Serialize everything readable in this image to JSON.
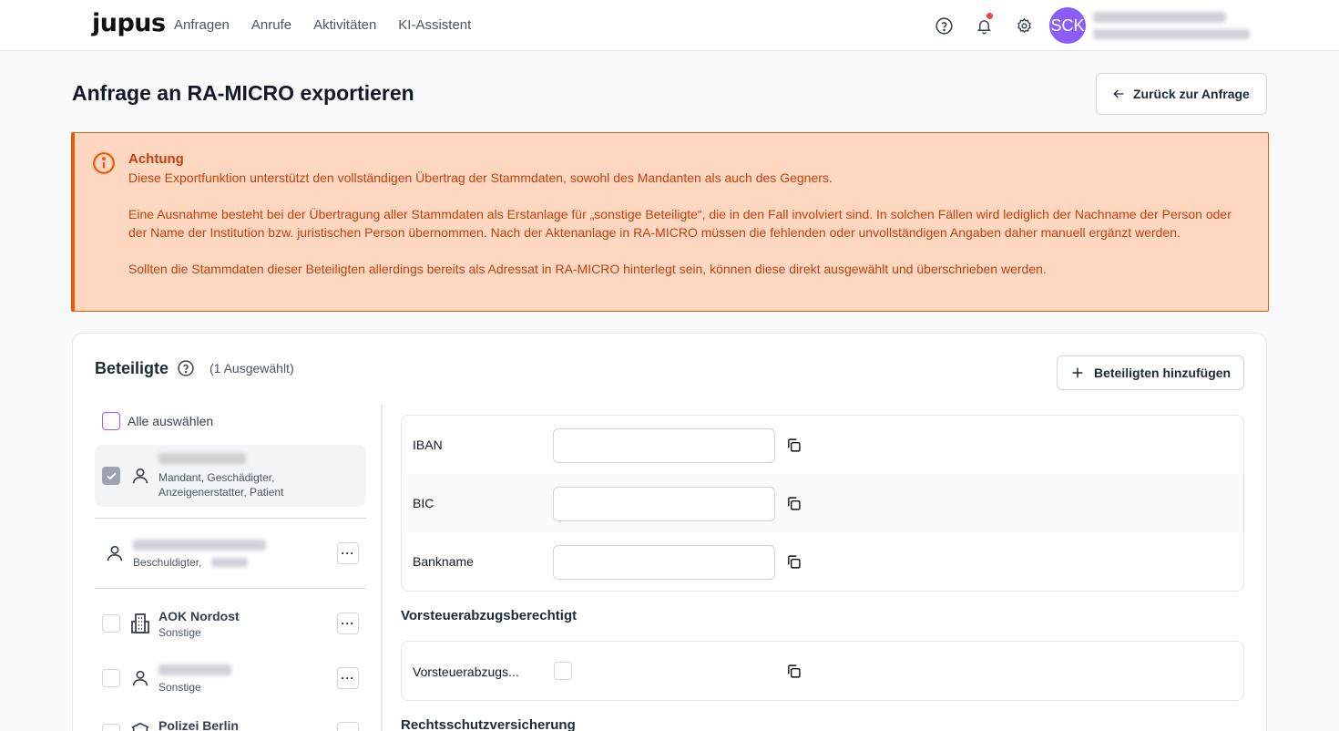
{
  "app": {
    "logo": "jupus",
    "nav": [
      "Anfragen",
      "Anrufe",
      "Aktivitäten",
      "KI-Assistent"
    ],
    "avatar_initials": "SCK",
    "icons": [
      "help-circle-icon",
      "bell-icon",
      "gear-icon"
    ],
    "notification_dot_color": "#ef4444"
  },
  "page": {
    "title": "Anfrage an RA-MICRO exportieren",
    "back_label": "Zurück zur Anfrage"
  },
  "alert": {
    "title": "Achtung",
    "paragraphs": [
      "Diese Exportfunktion unterstützt den vollständigen Übertrag der Stammdaten, sowohl des Mandanten als auch des Gegners.",
      "Eine Ausnahme besteht bei der Übertragung aller Stammdaten als Erstanlage für „sonstige Beteiligte“, die in den Fall involviert sind. In solchen Fällen wird lediglich der Nachname der Person oder der Name der Institution bzw. juristischen Person übernommen. Nach der Aktenanlage in RA-MICRO müssen die fehlenden oder unvollständigen Angaben daher manuell ergänzt werden.",
      "Sollten die Stammdaten dieser Beteiligten allerdings bereits als Adressat in RA-MICRO hinterlegt sein, können diese direkt ausgewählt und überschrieben werden."
    ],
    "color": "#c2410c"
  },
  "participants": {
    "title": "Beteiligte",
    "selected_count": "(1 Ausgewählt)",
    "add_label": "Beteiligten hinzufügen",
    "select_all": "Alle auswählen",
    "items": [
      {
        "name": "",
        "role_line1": "Mandant, Geschädigter,",
        "role_line2": "Anzeigenerstatter, Patient",
        "checked": true,
        "icon": "person-icon"
      },
      {
        "name": "",
        "role_line1": "Beschuldigter,",
        "icon": "person-icon"
      },
      {
        "name": "AOK Nordost",
        "role_line1": "Sonstige",
        "icon": "building-icon"
      },
      {
        "name": "",
        "role_line1": "Sonstige",
        "icon": "person-icon"
      },
      {
        "name": "Polizei Berlin",
        "icon": "institution-icon"
      }
    ],
    "more_label": "···"
  },
  "bank": {
    "fields": [
      {
        "label": "IBAN",
        "value": ""
      },
      {
        "label": "BIC",
        "value": ""
      },
      {
        "label": "Bankname",
        "value": ""
      }
    ]
  },
  "vat": {
    "heading": "Vorsteuerabzugsberechtigt",
    "field_label": "Vorsteuerabzugs..."
  },
  "insurance": {
    "heading": "Rechtsschutzversicherung"
  }
}
